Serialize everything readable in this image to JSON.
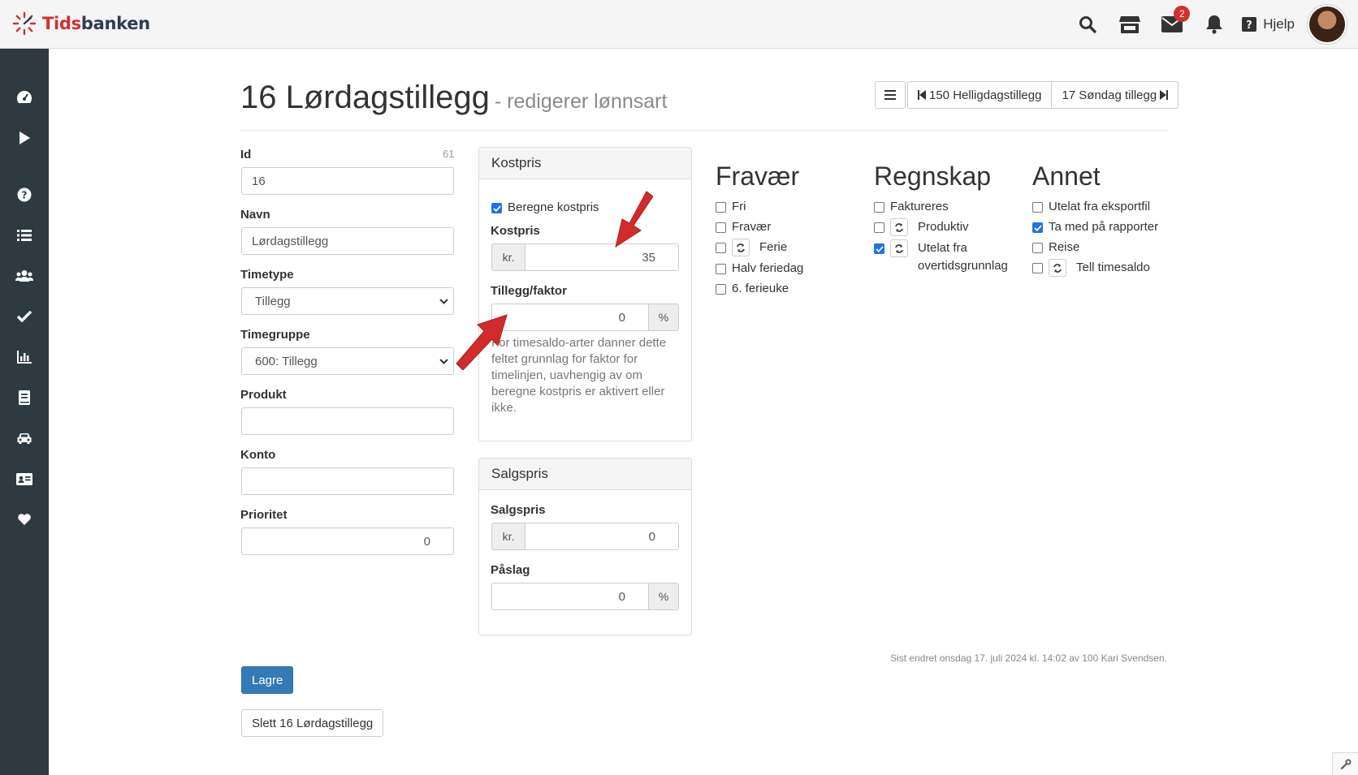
{
  "app": {
    "logo_prefix": "Tids",
    "logo_suffix": "banken"
  },
  "topbar": {
    "messages_count": "2",
    "help_label": "Hjelp"
  },
  "page": {
    "title": "16 Lørdagstillegg",
    "subtitle": "- redigerer lønnsart"
  },
  "nav": {
    "prev_label": "150 Helligdagstillegg",
    "next_label": "17 Søndag tillegg"
  },
  "form": {
    "id_label": "Id",
    "id_hint": "61",
    "id_value": "16",
    "navn_label": "Navn",
    "navn_value": "Lørdagstillegg",
    "timetype_label": "Timetype",
    "timetype_value": "Tillegg",
    "timegruppe_label": "Timegruppe",
    "timegruppe_value": "600: Tillegg",
    "produkt_label": "Produkt",
    "produkt_value": "",
    "konto_label": "Konto",
    "konto_value": "",
    "prioritet_label": "Prioritet",
    "prioritet_value": "0"
  },
  "kostpris": {
    "panel_title": "Kostpris",
    "beregne_label": "Beregne kostpris",
    "beregne_checked": true,
    "kostpris_label": "Kostpris",
    "currency": "kr.",
    "kostpris_value": "35",
    "tillegg_label": "Tillegg/faktor",
    "tillegg_value": "0",
    "percent": "%",
    "help": "For timesaldo-arter danner dette feltet grunnlag for faktor for timelinjen, uavhengig av om beregne kostpris er aktivert eller ikke."
  },
  "salgspris": {
    "panel_title": "Salgspris",
    "salgspris_label": "Salgspris",
    "currency": "kr.",
    "salgspris_value": "0",
    "paslag_label": "Påslag",
    "paslag_value": "0",
    "percent": "%"
  },
  "fravaer": {
    "title": "Fravær",
    "items": [
      {
        "label": "Fri",
        "checked": false,
        "refresh": false
      },
      {
        "label": "Fravær",
        "checked": false,
        "refresh": false
      },
      {
        "label": "Ferie",
        "checked": false,
        "refresh": true
      },
      {
        "label": "Halv feriedag",
        "checked": false,
        "refresh": false
      },
      {
        "label": "6. ferieuke",
        "checked": false,
        "refresh": false
      }
    ]
  },
  "regnskap": {
    "title": "Regnskap",
    "items": [
      {
        "label": "Faktureres",
        "checked": false,
        "refresh": false
      },
      {
        "label": "Produktiv",
        "checked": false,
        "refresh": true
      },
      {
        "label": "Utelat fra overtidsgrunnlag",
        "checked": true,
        "refresh": true
      }
    ]
  },
  "annet": {
    "title": "Annet",
    "items": [
      {
        "label": "Utelat fra eksportfil",
        "checked": false,
        "refresh": false
      },
      {
        "label": "Ta med på rapporter",
        "checked": true,
        "refresh": false
      },
      {
        "label": "Reise",
        "checked": false,
        "refresh": false
      },
      {
        "label": "Tell timesaldo",
        "checked": false,
        "refresh": true
      }
    ]
  },
  "footer": {
    "last_changed": "Sist endret onsdag 17. juli 2024 kl. 14:02 av 100 Kari Svendsen.",
    "save_label": "Lagre",
    "delete_label": "Slett 16 Lørdagstillegg"
  },
  "colors": {
    "sidebar": "#2d3a40",
    "primary": "#337ab7",
    "accent_red": "#d32f2f",
    "arrow": "#d12b2b"
  }
}
